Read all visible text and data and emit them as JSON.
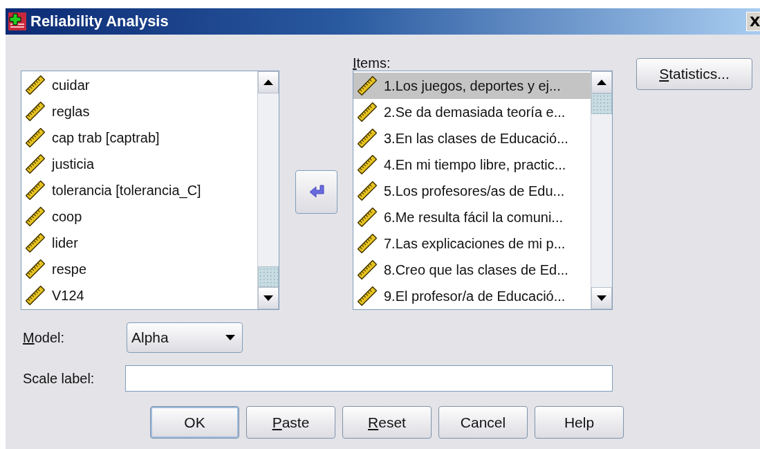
{
  "window": {
    "title": "Reliability Analysis",
    "close": "X"
  },
  "variables": [
    {
      "label": "cuidar",
      "selected": false
    },
    {
      "label": "reglas",
      "selected": false
    },
    {
      "label": "cap trab [captrab]",
      "selected": false
    },
    {
      "label": "justicia",
      "selected": false
    },
    {
      "label": "tolerancia [tolerancia_C]",
      "selected": false
    },
    {
      "label": "coop",
      "selected": false
    },
    {
      "label": "lider",
      "selected": false
    },
    {
      "label": "respe",
      "selected": false
    },
    {
      "label": "V124",
      "selected": false
    }
  ],
  "items": {
    "label": "Items:",
    "mnemonic": true,
    "list": [
      {
        "label": "1.Los juegos, deportes y ej...",
        "selected": true
      },
      {
        "label": "2.Se da demasiada teoría e...",
        "selected": false
      },
      {
        "label": "3.En las clases de Educació...",
        "selected": false
      },
      {
        "label": "4.En mi tiempo libre, practic...",
        "selected": false
      },
      {
        "label": "5.Los profesores/as de Edu...",
        "selected": false
      },
      {
        "label": "6.Me resulta fácil la comuni...",
        "selected": false
      },
      {
        "label": "7.Las explicaciones de mi p...",
        "selected": false
      },
      {
        "label": "8.Creo que las clases de Ed...",
        "selected": false
      },
      {
        "label": "9.El profesor/a de Educació...",
        "selected": false
      }
    ]
  },
  "statistics_button": {
    "label": "Statistics...",
    "mnemonic": true
  },
  "model": {
    "label": "Model:",
    "mnemonic": true,
    "value": "Alpha"
  },
  "scale_label": {
    "label": "Scale label:",
    "mnemonic": false
  },
  "buttons": [
    {
      "label": "OK",
      "mnemonic": false,
      "default": true
    },
    {
      "label": "Paste",
      "mnemonic": true,
      "default": false
    },
    {
      "label": "Reset",
      "mnemonic": true,
      "default": false
    },
    {
      "label": "Cancel",
      "mnemonic": false,
      "default": false
    },
    {
      "label": "Help",
      "mnemonic": false,
      "default": false
    }
  ]
}
